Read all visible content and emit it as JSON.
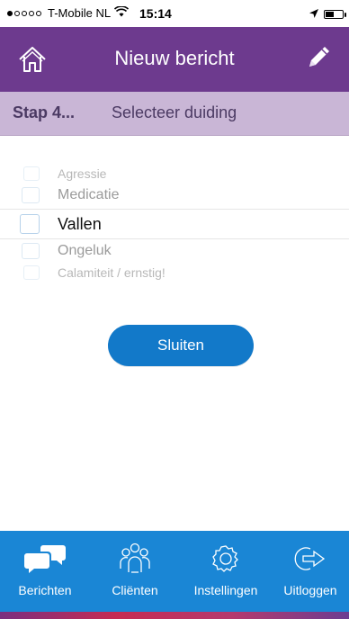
{
  "status_bar": {
    "carrier": "T-Mobile NL",
    "time": "15:14",
    "wifi_icon": "wifi-icon",
    "location_icon": "location-arrow-icon",
    "battery_icon": "battery-icon"
  },
  "header": {
    "title": "Nieuw bericht",
    "home_icon": "home-icon",
    "edit_icon": "pencil-icon",
    "background": "#6d3a8e"
  },
  "step": {
    "number": "Stap 4...",
    "label": "Selecteer duiding"
  },
  "picker": {
    "options": [
      "Agressie",
      "Medicatie",
      "Vallen",
      "Ongeluk",
      "Calamiteit / ernstig!"
    ],
    "selected": "Vallen"
  },
  "close_button": {
    "label": "Sluiten",
    "color": "#1279c9"
  },
  "tabbar": {
    "background": "#1a86d5",
    "tabs": [
      {
        "label": "Berichten",
        "icon": "chat-bubbles-icon"
      },
      {
        "label": "Cliënten",
        "icon": "people-group-icon"
      },
      {
        "label": "Instellingen",
        "icon": "gears-icon"
      },
      {
        "label": "Uitloggen",
        "icon": "logout-arrow-icon"
      }
    ]
  }
}
